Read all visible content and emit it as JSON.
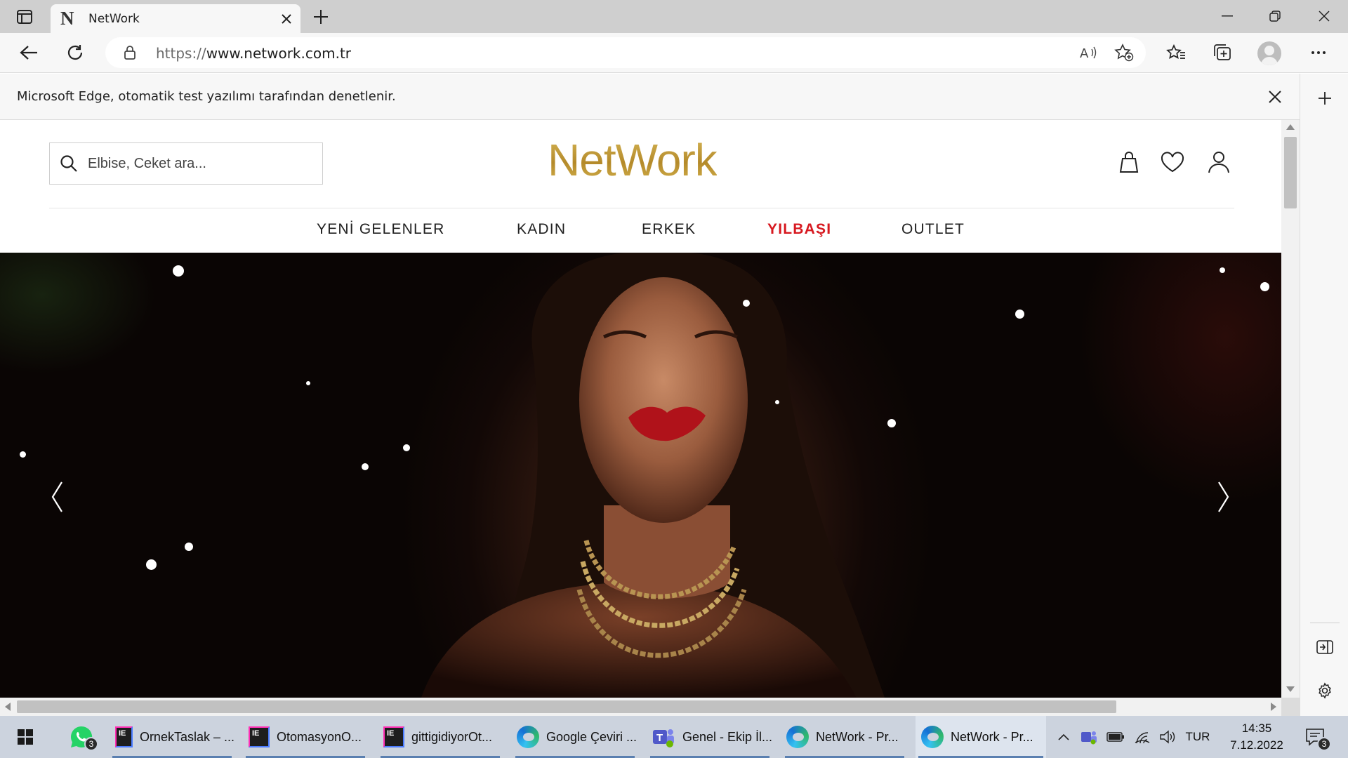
{
  "browser": {
    "tab_title": "NetWork",
    "tab_favicon": "N",
    "url_protocol": "https://",
    "url_host": "www.network.com.tr",
    "infobar_message": "Microsoft Edge, otomatik test yazılımı tarafından denetlenir."
  },
  "site": {
    "logo": "NetWork",
    "logo_color": "#c2a140",
    "search_placeholder": "Elbise, Ceket ara...",
    "nav": [
      {
        "label": "YENİ GELENLER",
        "highlight": false
      },
      {
        "label": "KADIN",
        "highlight": false
      },
      {
        "label": "ERKEK",
        "highlight": false
      },
      {
        "label": "YILBAŞI",
        "highlight": true
      },
      {
        "label": "OUTLET",
        "highlight": false
      }
    ],
    "highlight_color": "#d71920",
    "header_icons": [
      "cart-icon",
      "heart-icon",
      "user-icon"
    ],
    "hero": {
      "description_icon_left": "chevron-left-icon",
      "description_icon_right": "chevron-right-icon"
    }
  },
  "taskbar": {
    "whatsapp_badge": "3",
    "items": [
      {
        "label": "OrnekTaslak – ...",
        "icon": "intellij-icon"
      },
      {
        "label": "OtomasyonO...",
        "icon": "intellij-icon"
      },
      {
        "label": "gittigidiyorOt...",
        "icon": "intellij-icon"
      },
      {
        "label": "Google Çeviri ...",
        "icon": "edge-icon"
      },
      {
        "label": "Genel - Ekip İl...",
        "icon": "teams-icon"
      },
      {
        "label": "NetWork - Pr...",
        "icon": "edge-icon"
      },
      {
        "label": "NetWork - Pr...",
        "icon": "edge-icon"
      }
    ],
    "language": "TUR",
    "time": "14:35",
    "date": "7.12.2022",
    "notification_badge": "3"
  }
}
